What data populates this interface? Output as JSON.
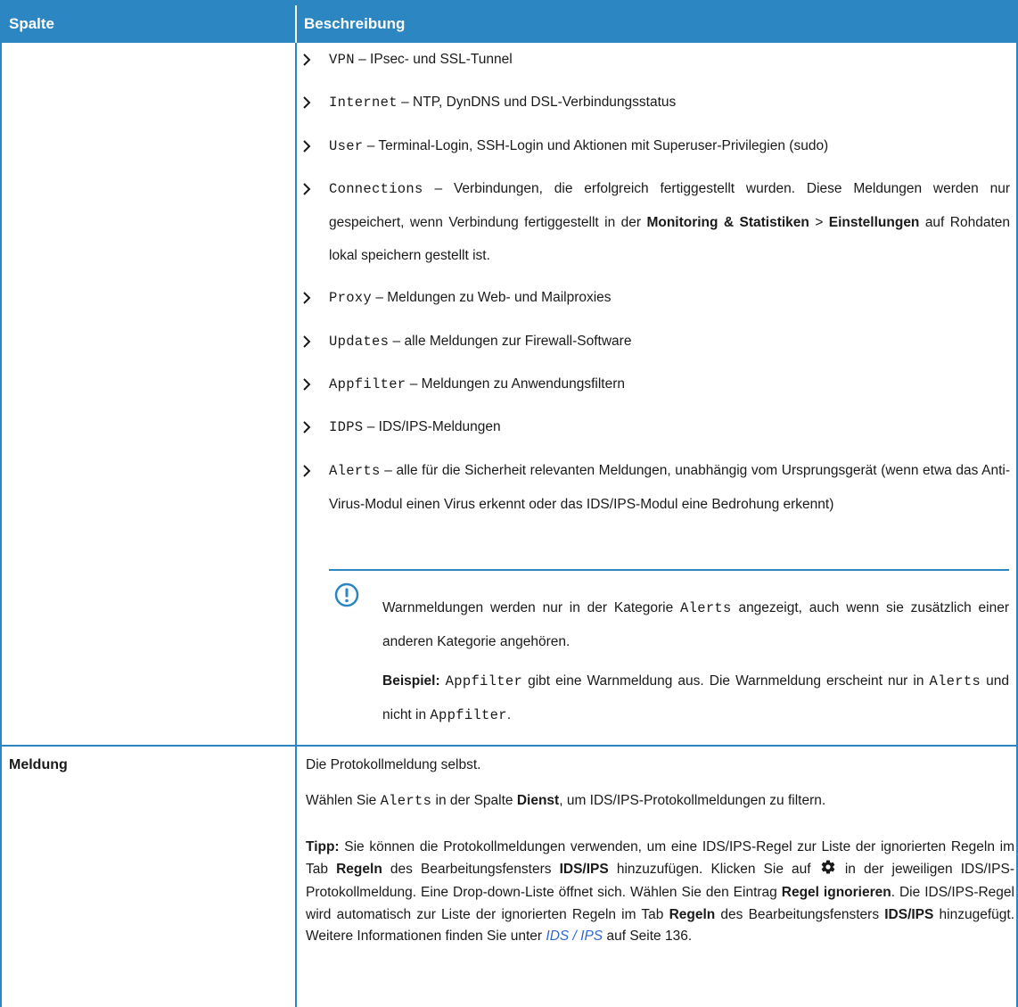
{
  "header": {
    "col1": "Spalte",
    "col2": "Beschreibung"
  },
  "row1": {
    "bullets": [
      {
        "code": "VPN",
        "sep": " – ",
        "text": "IPsec- und SSL-Tunnel"
      },
      {
        "code": "Internet",
        "sep": " – ",
        "text": "NTP, DynDNS und DSL-Verbindungsstatus"
      },
      {
        "code": "User",
        "sep": " – ",
        "text": "Terminal-Login, SSH-Login und Aktionen mit Superuser-Privilegien (sudo)"
      },
      {
        "code": "Connections",
        "sep": " – ",
        "text": "Verbindungen, die erfolgreich fertiggestellt wurden. Diese Meldungen werden nur gespeichert, wenn Verbindung fertiggestellt in der ",
        "bold1": "Monitoring & Statistiken",
        "mid": " > ",
        "bold2": "Einstellungen",
        "tail": " auf Rohdaten lokal speichern gestellt ist."
      },
      {
        "code": "Proxy",
        "sep": " – ",
        "text": "Meldungen zu Web- und Mailproxies"
      },
      {
        "code": "Updates",
        "sep": " – ",
        "text": "alle Meldungen zur Firewall-Software"
      },
      {
        "code": "Appfilter",
        "sep": " – ",
        "text": "Meldungen zu Anwendungsfiltern"
      },
      {
        "code": "IDPS",
        "sep": " – ",
        "text": "IDS/IPS-Meldungen"
      },
      {
        "code": "Alerts",
        "sep": " – ",
        "text": "alle für die Sicherheit relevanten Meldungen, unabhängig vom Ursprungsgerät (wenn etwa das Anti-Virus-Modul einen Virus erkennt oder das IDS/IPS-Modul eine Bedrohung erkennt)"
      }
    ],
    "note": {
      "icon": "exclamation-circle-icon",
      "p1_a": "Warnmeldungen werden nur in der Kategorie ",
      "p1_code": "Alerts",
      "p1_b": " angezeigt, auch wenn sie zusätzlich einer anderen Kategorie angehören.",
      "p2_label": "Beispiel:",
      "p2_code1": "Appfilter",
      "p2_a": " gibt eine Warnmeldung aus. Die Warnmeldung erscheint nur in ",
      "p2_code2": "Alerts",
      "p2_b": " und nicht in ",
      "p2_code3": "Appfilter",
      "p2_c": "."
    }
  },
  "row2": {
    "label": "Meldung",
    "p1": "Die Protokollmeldung selbst.",
    "p2_a": "Wählen Sie ",
    "p2_code": "Alerts",
    "p2_b": " in der Spalte ",
    "p2_bold": "Dienst",
    "p2_c": ", um IDS/IPS-Protokollmeldungen zu filtern.",
    "tip_label": "Tipp:",
    "tip_1": " Sie können die Protokollmeldungen verwenden, um eine IDS/IPS-Regel zur Liste der ignorierten Regeln im Tab ",
    "tip_b1": "Regeln",
    "tip_2": " des Bearbeitungsfensters ",
    "tip_b2": "IDS/IPS",
    "tip_3": " hinzuzufügen. Klicken Sie auf ",
    "tip_icon": "gear-icon",
    "tip_4": " in der jeweiligen IDS/IPS-Protokollmeldung. Eine Drop-down-Liste öffnet sich. Wählen Sie den Eintrag ",
    "tip_b3": "Regel ignorieren",
    "tip_5": ". Die IDS/IPS-Regel wird automatisch zur Liste der ignorierten Regeln im Tab ",
    "tip_b4": "Regeln",
    "tip_6": " des Bearbeitungsfensters ",
    "tip_b5": "IDS/IPS",
    "tip_7": " hinzugefügt. Weitere Informationen finden Sie unter ",
    "tip_link": "IDS / IPS",
    "tip_8": " auf Seite 136."
  },
  "colors": {
    "accent": "#2b86c2",
    "link": "#3366cc"
  }
}
